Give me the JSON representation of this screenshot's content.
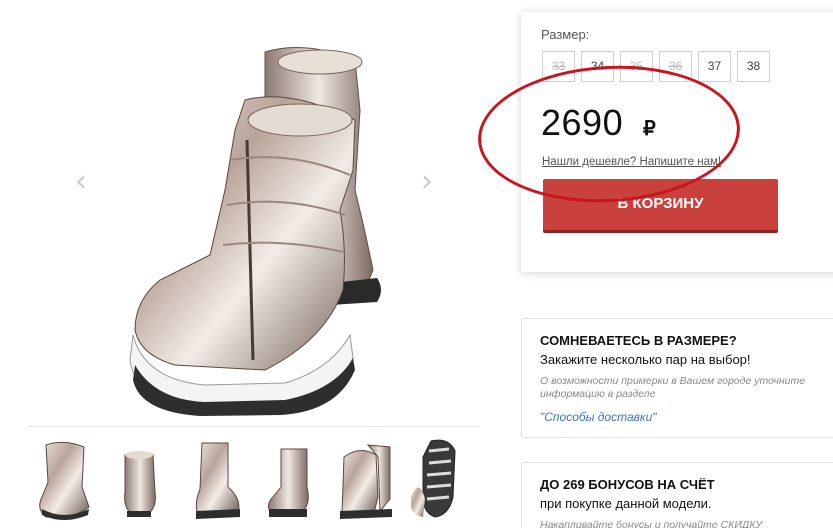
{
  "gallery": {
    "prev_icon": "chevron-left-icon",
    "next_icon": "chevron-right-icon",
    "prev_glyph": "‹",
    "next_glyph": "›",
    "thumbnail_count": 6
  },
  "purchase": {
    "size_label": "Размер:",
    "sizes": [
      {
        "label": "33",
        "available": false
      },
      {
        "label": "34",
        "available": true
      },
      {
        "label": "35",
        "available": false
      },
      {
        "label": "36",
        "available": false
      },
      {
        "label": "37",
        "available": true
      },
      {
        "label": "38",
        "available": true
      }
    ],
    "price": "2690",
    "currency": "₽",
    "cheaper_link": "Нашли дешевле? Напишите нам!",
    "cart_button": "В КОРЗИНУ",
    "highlight_color": "#c7161f",
    "button_color": "#c9403c"
  },
  "size_help": {
    "title": "СОМНЕВАЕТЕСЬ В РАЗМЕРЕ?",
    "subtitle": "Закажите несколько пар на выбор!",
    "note": "О возможности примерки в Вашем городе уточните информацию в разделе",
    "link": "\"Способы доставки\"",
    "link_color": "#3d74b7"
  },
  "bonus": {
    "title": "ДО 269 БОНУСОВ НА СЧЁТ",
    "subtitle": "при покупке данной модели.",
    "note": "Накапливайте бонусы и получайте СКИДКУ"
  }
}
